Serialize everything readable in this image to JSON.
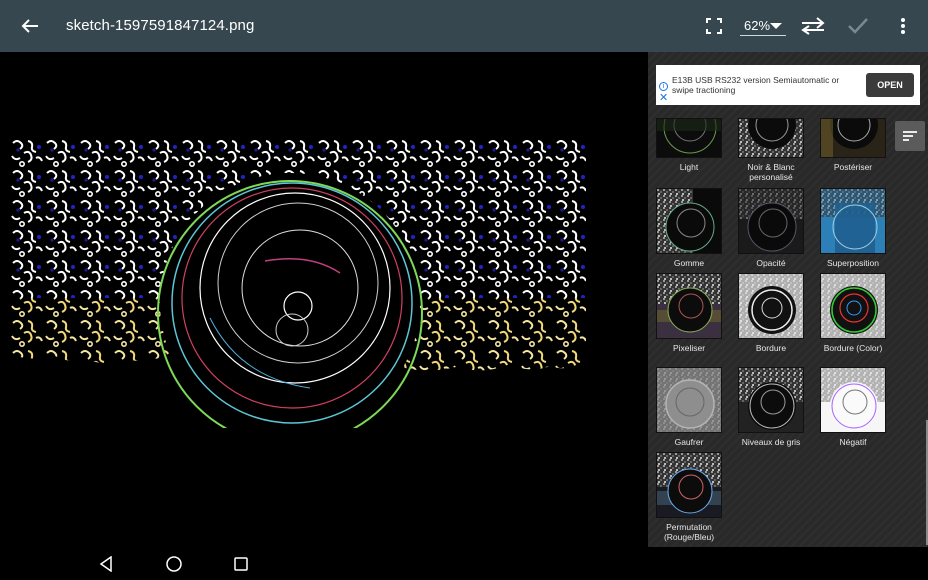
{
  "appbar": {
    "back_icon": "arrow-left-icon",
    "filename": "sketch-1597591847124.png",
    "fullscreen_icon": "fullscreen-icon",
    "zoom": "62%",
    "swap_icon": "swap-arrows-icon",
    "apply_icon": "check-icon",
    "more_icon": "more-vert-icon"
  },
  "ad": {
    "text": "E13B USB RS232 version Semiautomatic or swipe tractioning",
    "button": "OPEN"
  },
  "filters": [
    {
      "label": "Light"
    },
    {
      "label": "Noir & Blanc personalisé"
    },
    {
      "label": "Postériser"
    },
    {
      "label": "Gomme"
    },
    {
      "label": "Opacité"
    },
    {
      "label": "Superposition"
    },
    {
      "label": "Pixeliser"
    },
    {
      "label": "Bordure"
    },
    {
      "label": "Bordure (Color)"
    },
    {
      "label": "Gaufrer"
    },
    {
      "label": "Niveaux de gris"
    },
    {
      "label": "Négatif"
    },
    {
      "label": "Permutation (Rouge/Bleu)"
    }
  ],
  "navbar": {
    "back": "nav-back-icon",
    "home": "nav-home-icon",
    "recents": "nav-recents-icon"
  },
  "colors": {
    "appbar": "#37474f",
    "panel": "#2b2b2b",
    "accent_ring": "#7ed957"
  }
}
